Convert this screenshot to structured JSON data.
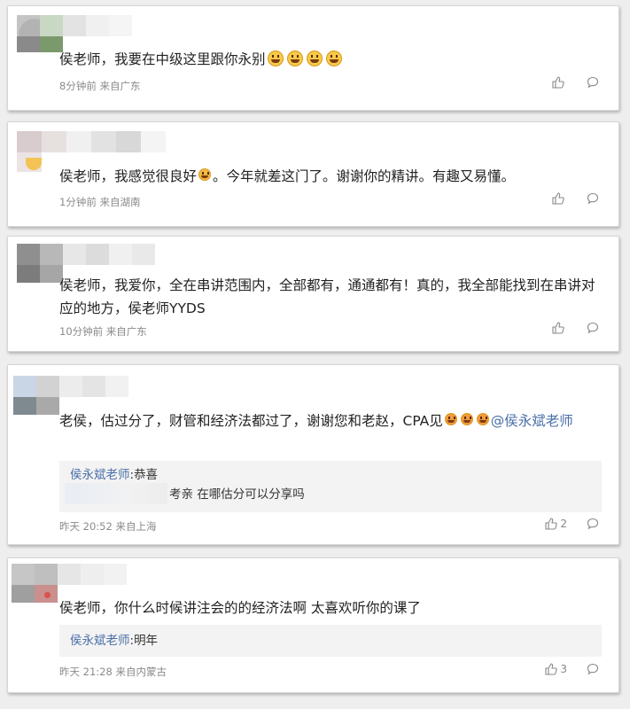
{
  "comments": [
    {
      "text": "侯老师，我要在中级这里跟你永别",
      "time": "8分钟前",
      "location": "来自广东",
      "likes": ""
    },
    {
      "text_a": "侯老师，我感觉很良好",
      "text_b": "。今年就差这门了。谢谢你的精讲。有趣又易懂。",
      "time": "1分钟前",
      "location": "来自湖南",
      "likes": ""
    },
    {
      "text": "侯老师，我爱你，全在串讲范围内，全部都有，通通都有！真的，我全部能找到在串讲对应的地方，侯老师YYDS",
      "time": "10分钟前",
      "location": "来自广东",
      "likes": ""
    },
    {
      "text": "老侯，估过分了，财管和经济法都过了，谢谢您和老赵，CPA见",
      "mention": "@侯永斌老师",
      "replies": [
        {
          "name": "侯永斌老师",
          "sep": ":",
          "text": "恭喜"
        },
        {
          "name": "",
          "sep": "",
          "text": "考亲 在哪估分可以分享吗"
        }
      ],
      "time": "昨天 20:52",
      "location": "来自上海",
      "likes": "2"
    },
    {
      "text": "侯老师，你什么时候讲注会的的经济法啊 太喜欢听你的课了",
      "replies": [
        {
          "name": "侯永斌老师",
          "sep": ":",
          "text": "明年"
        }
      ],
      "time": "昨天 21:28",
      "location": "来自内蒙古",
      "likes": "3"
    }
  ],
  "icons": {
    "like": "thumbs-up-icon",
    "comment": "comment-bubble-icon",
    "emoji": "grinning-face-icon"
  },
  "colors": {
    "mention": "#4a6fa8",
    "meta": "#8a8a8a",
    "reply_bg": "#f3f3f3"
  }
}
